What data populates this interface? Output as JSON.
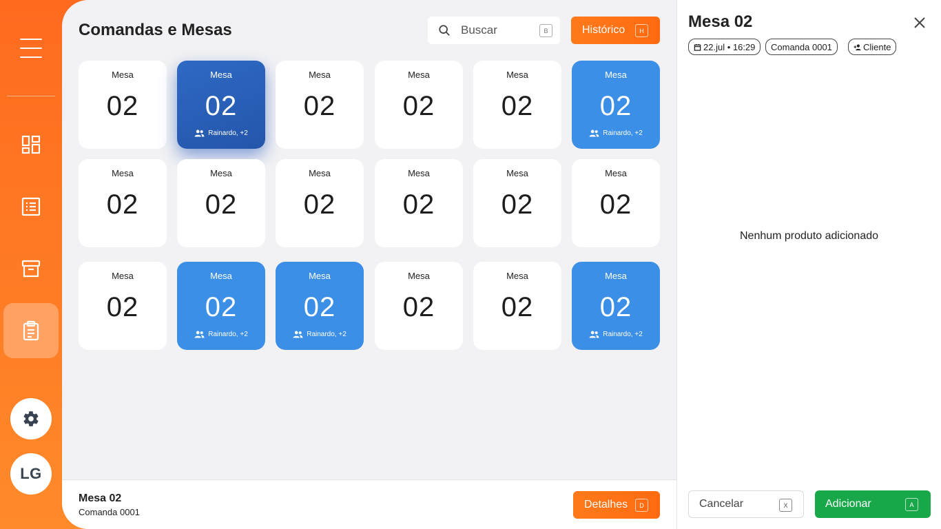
{
  "sidebar": {
    "avatar_initials": "LG",
    "nav_items": [
      {
        "icon": "dashboard-icon",
        "active": false
      },
      {
        "icon": "list-icon",
        "active": false
      },
      {
        "icon": "archive-icon",
        "active": false
      },
      {
        "icon": "clipboard-icon",
        "active": true
      }
    ]
  },
  "header": {
    "title": "Comandas e Mesas",
    "search": {
      "placeholder": "Buscar",
      "shortcut": "B"
    },
    "history_button": {
      "label": "Histórico",
      "shortcut": "H"
    }
  },
  "tables": [
    {
      "label": "Mesa",
      "number": "02",
      "state": "free",
      "guests": ""
    },
    {
      "label": "Mesa",
      "number": "02",
      "state": "selected",
      "guests": "Rainardo, +2"
    },
    {
      "label": "Mesa",
      "number": "02",
      "state": "free",
      "guests": ""
    },
    {
      "label": "Mesa",
      "number": "02",
      "state": "free",
      "guests": ""
    },
    {
      "label": "Mesa",
      "number": "02",
      "state": "free",
      "guests": ""
    },
    {
      "label": "Mesa",
      "number": "02",
      "state": "occupied",
      "guests": "Rainardo, +2"
    },
    {
      "label": "Mesa",
      "number": "02",
      "state": "free",
      "guests": ""
    },
    {
      "label": "Mesa",
      "number": "02",
      "state": "free",
      "guests": ""
    },
    {
      "label": "Mesa",
      "number": "02",
      "state": "free",
      "guests": ""
    },
    {
      "label": "Mesa",
      "number": "02",
      "state": "free",
      "guests": ""
    },
    {
      "label": "Mesa",
      "number": "02",
      "state": "free",
      "guests": ""
    },
    {
      "label": "Mesa",
      "number": "02",
      "state": "free",
      "guests": ""
    },
    {
      "label": "Mesa",
      "number": "02",
      "state": "free",
      "guests": ""
    },
    {
      "label": "Mesa",
      "number": "02",
      "state": "occupied",
      "guests": "Rainardo, +2"
    },
    {
      "label": "Mesa",
      "number": "02",
      "state": "occupied",
      "guests": "Rainardo, +2"
    },
    {
      "label": "Mesa",
      "number": "02",
      "state": "free",
      "guests": ""
    },
    {
      "label": "Mesa",
      "number": "02",
      "state": "free",
      "guests": ""
    },
    {
      "label": "Mesa",
      "number": "02",
      "state": "occupied",
      "guests": "Rainardo, +2"
    }
  ],
  "bottom_bar": {
    "title": "Mesa 02",
    "subtitle": "Comanda 0001",
    "details_button": {
      "label": "Detalhes",
      "shortcut": "D"
    }
  },
  "detail_panel": {
    "title": "Mesa 02",
    "chips": {
      "date": "22.jul • 16:29",
      "order": "Comanda 0001",
      "client": "Cliente"
    },
    "empty_message": "Nenhum produto adicionado",
    "cancel_button": {
      "label": "Cancelar",
      "shortcut": "X"
    },
    "add_button": {
      "label": "Adicionar",
      "shortcut": "A"
    }
  },
  "colors": {
    "brand_orange": "#ff6a1f",
    "occupied_blue": "#3b8fe6",
    "selected_blue": "#2456ab",
    "add_green": "#18a84a"
  }
}
